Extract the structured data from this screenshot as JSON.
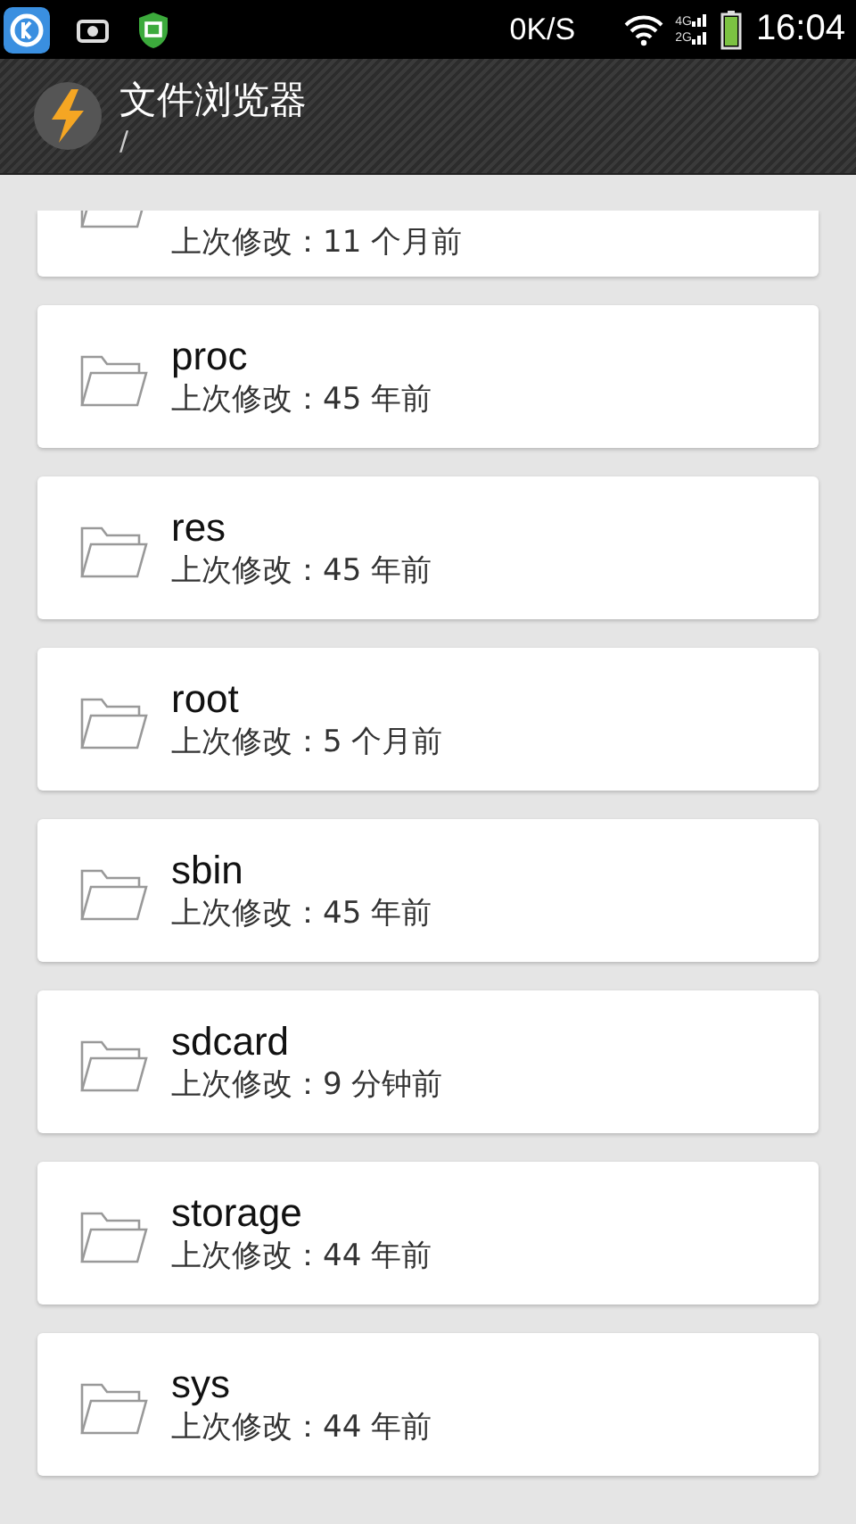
{
  "status_bar": {
    "speed": "0K/S",
    "network_labels": [
      "4G",
      "2G"
    ],
    "time": "16:04"
  },
  "app_bar": {
    "title": "文件浏览器",
    "path": "/"
  },
  "files": [
    {
      "modified": "上次修改：11 个月前"
    },
    {
      "name": "proc",
      "modified": "上次修改：45 年前"
    },
    {
      "name": "res",
      "modified": "上次修改：45 年前"
    },
    {
      "name": "root",
      "modified": "上次修改：5 个月前"
    },
    {
      "name": "sbin",
      "modified": "上次修改：45 年前"
    },
    {
      "name": "sdcard",
      "modified": "上次修改：9 分钟前"
    },
    {
      "name": "storage",
      "modified": "上次修改：44 年前"
    },
    {
      "name": "sys",
      "modified": "上次修改：44 年前"
    }
  ]
}
